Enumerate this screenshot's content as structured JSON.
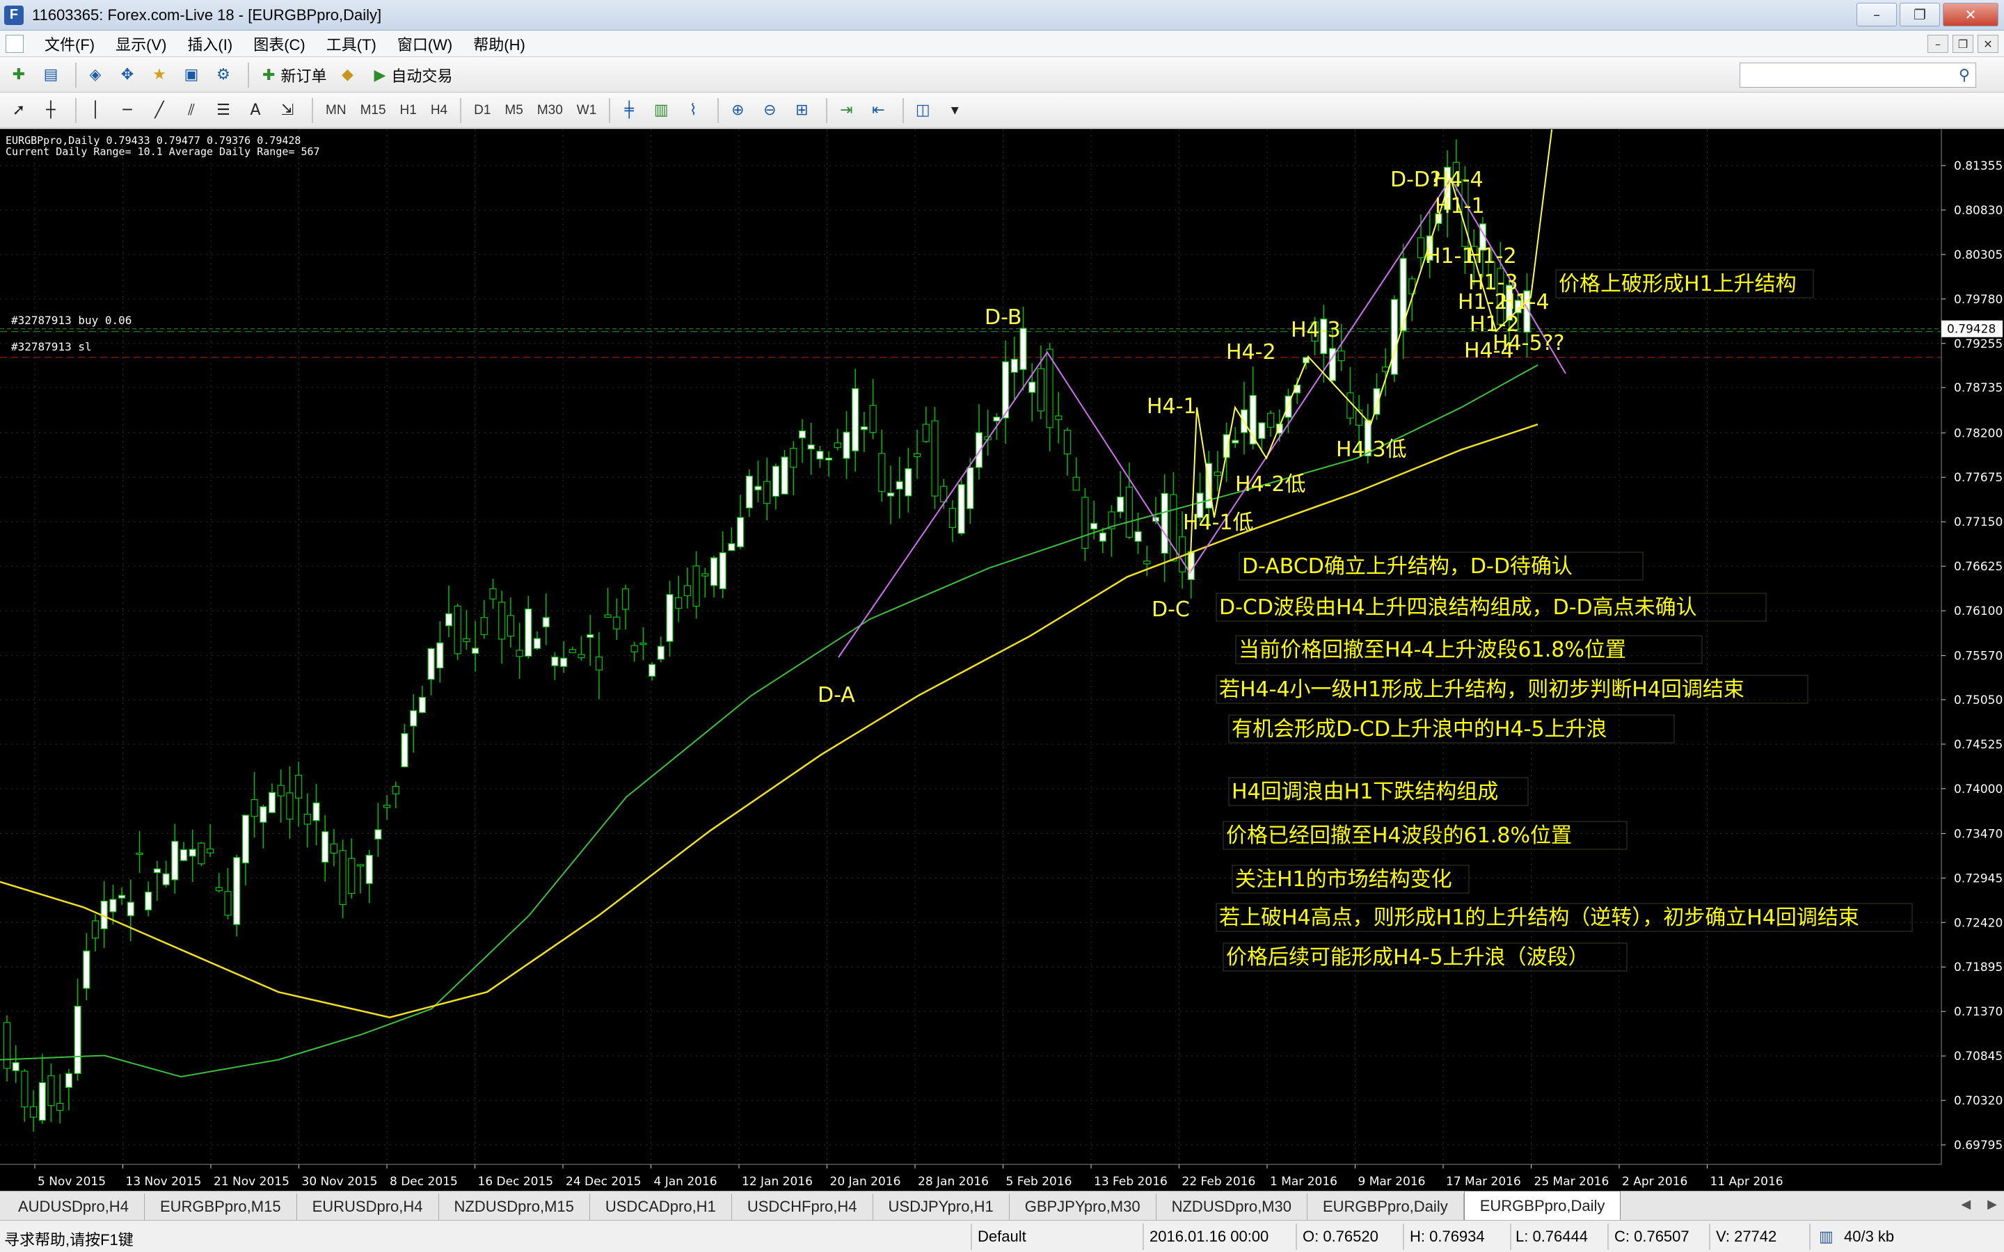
{
  "window": {
    "title": "11603365: Forex.com-Live 18 - [EURGBPpro,Daily]",
    "app_icon": "F"
  },
  "menu": {
    "items": [
      "文件(F)",
      "显示(V)",
      "插入(I)",
      "图表(C)",
      "工具(T)",
      "窗口(W)",
      "帮助(H)"
    ]
  },
  "toolbar": {
    "new_order_label": "新订单",
    "auto_trading_label": "自动交易",
    "timeframes": [
      "MN",
      "M15",
      "H1",
      "H4",
      "D1",
      "M5",
      "M30",
      "W1"
    ],
    "text_tool": "A"
  },
  "chart": {
    "info_line1": "EURGBPpro,Daily  0.79433 0.79477 0.79376 0.79428",
    "info_line2": "Current Daily Range= 10.1   Average Daily Range= 567",
    "trade_buy_label": "#32787913 buy 0.06",
    "trade_sl_label": "#32787913 sl",
    "current_price": "0.79428",
    "price_labels": [
      "0.81355",
      "0.80830",
      "0.80305",
      "0.79780",
      "0.79255",
      "0.78735",
      "0.78200",
      "0.77675",
      "0.77150",
      "0.76625",
      "0.76100",
      "0.75570",
      "0.75050",
      "0.74525",
      "0.74000",
      "0.73470",
      "0.72945",
      "0.72420",
      "0.71895",
      "0.71370",
      "0.70845",
      "0.70320",
      "0.69795"
    ],
    "date_labels": [
      "5 Nov 2015",
      "13 Nov 2015",
      "21 Nov 2015",
      "30 Nov 2015",
      "8 Dec 2015",
      "16 Dec 2015",
      "24 Dec 2015",
      "4 Jan 2016",
      "12 Jan 2016",
      "20 Jan 2016",
      "28 Jan 2016",
      "5 Feb 2016",
      "13 Feb 2016",
      "22 Feb 2016",
      "1 Mar 2016",
      "9 Mar 2016",
      "17 Mar 2016",
      "25 Mar 2016",
      "2 Apr 2016",
      "11 Apr 2016"
    ],
    "wave_labels": {
      "da": "D-A",
      "db": "D-B",
      "dc": "D-C",
      "dd": "D-D?",
      "h41": "H4-1",
      "h42": "H4-2",
      "h43": "H4-3",
      "h44": "H4-4",
      "h41low": "H4-1低",
      "h42low": "H4-2低",
      "h43low": "H4-3低",
      "h11": "H1-1",
      "h11b": "H1-1",
      "h12": "H1-2",
      "h13": "H1-3",
      "h12b": "H1-2",
      "h12c": "H1-2",
      "h14": "H1-4",
      "h45": "H4-5??",
      "h44b": "H4-4"
    },
    "annotations": [
      "价格上破形成H1上升结构",
      "D-ABCD确立上升结构，D-D待确认",
      "D-CD波段由H4上升四浪结构组成，D-D高点未确认",
      "当前价格回撤至H4-4上升波段61.8%位置",
      "若H4-4小一级H1形成上升结构，则初步判断H4回调结束",
      "有机会形成D-CD上升浪中的H4-5上升浪",
      "H4回调浪由H1下跌结构组成",
      "价格已经回撤至H4波段的61.8%位置",
      "关注H1的市场结构变化",
      "若上破H4高点，则形成H1的上升结构（逆转），初步确立H4回调结束",
      "价格后续可能形成H4-5上升浪（波段）"
    ],
    "colors": {
      "background": "#000000",
      "bull_candle": "#ffffff",
      "bear_candle": "#000000",
      "candle_outline": "#00c000",
      "ma_fast": "#3cc03c",
      "ma_slow": "#f0e020",
      "wave_yellow": "#ffff40",
      "wave_violet": "#d070f0",
      "annotation_text": "#ffff00",
      "grid": "#2e2e2e"
    }
  },
  "tabs": [
    "AUDUSDpro,H4",
    "EURGBPpro,M15",
    "EURUSDpro,H4",
    "NZDUSDpro,M15",
    "USDCADpro,H1",
    "USDCHFpro,H4",
    "USDJPYpro,H1",
    "GBPJPYpro,M30",
    "NZDUSDpro,M30",
    "EURGBPpro,Daily",
    "EURGBPpro,Daily"
  ],
  "status": {
    "help": "寻求帮助,请按F1键",
    "profile": "Default",
    "datetime": "2016.01.16 00:00",
    "open": "O: 0.76520",
    "high": "H: 0.76934",
    "low": "L: 0.76444",
    "close": "C: 0.76507",
    "volume": "V: 27742",
    "traffic": "40/3 kb"
  }
}
